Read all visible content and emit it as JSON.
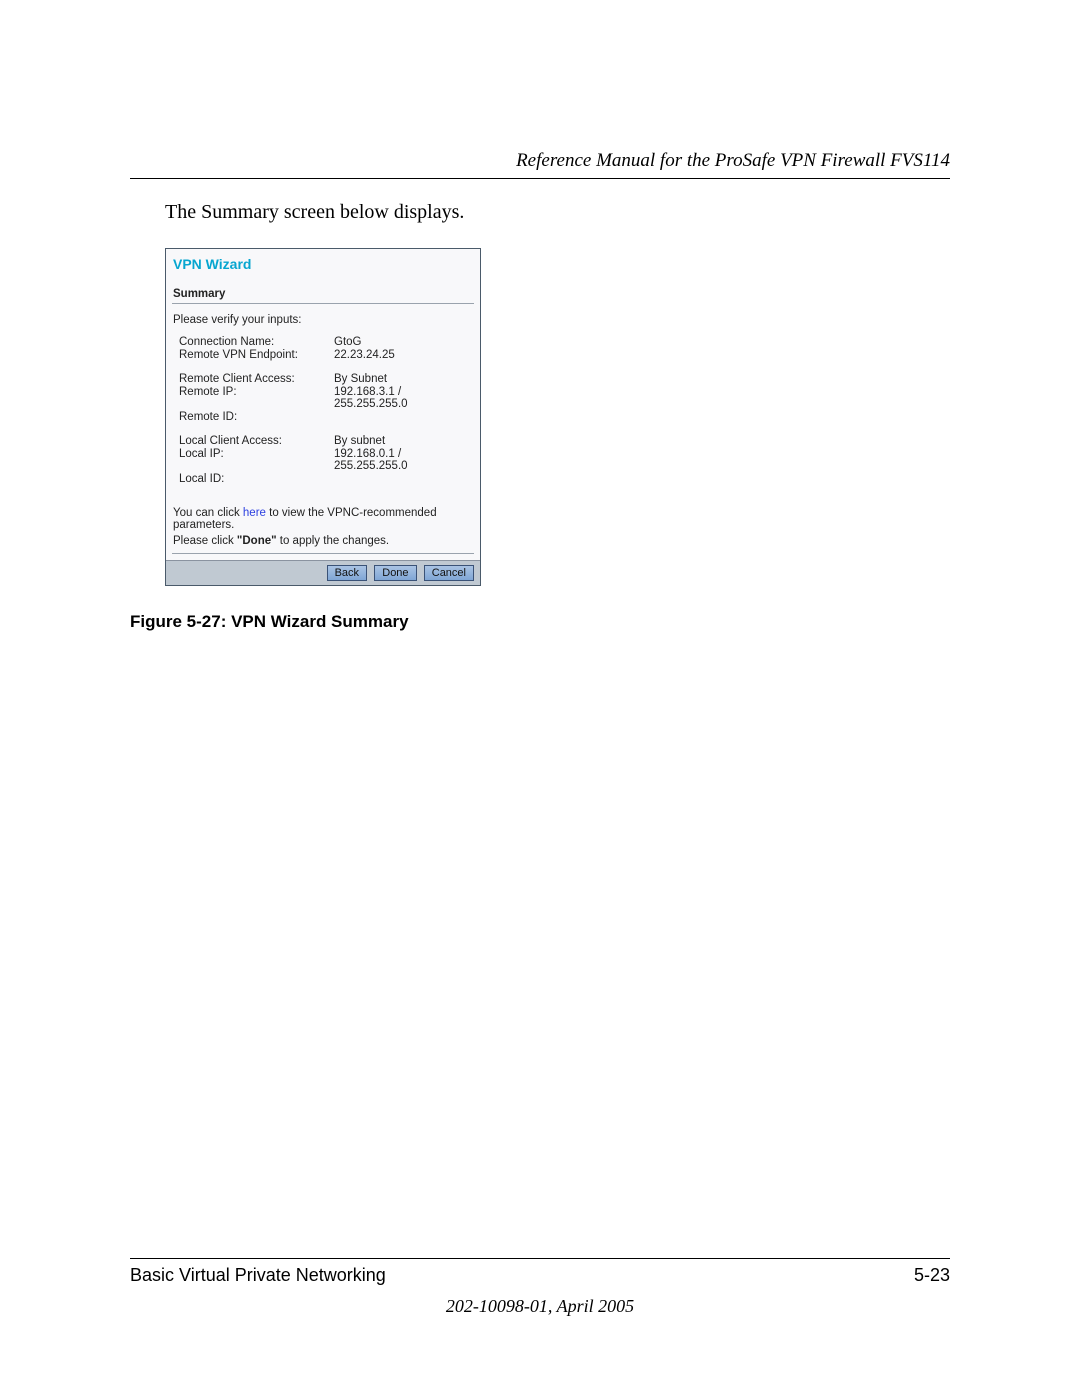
{
  "header": {
    "title": "Reference Manual for the ProSafe VPN Firewall FVS114"
  },
  "intro_text": "The Summary screen below displays.",
  "wizard": {
    "title": "VPN Wizard",
    "section": "Summary",
    "verify": "Please verify your inputs:",
    "fields": {
      "conn_label": "Connection Name:",
      "conn_val": "GtoG",
      "remote_ep_label": "Remote VPN Endpoint:",
      "remote_ep_val": "22.23.24.25",
      "rca_label": "Remote Client Access:",
      "rca_val": "By Subnet",
      "remote_ip_label": "Remote IP:",
      "remote_ip_val": "192.168.3.1 / 255.255.255.0",
      "remote_id_label": "Remote ID:",
      "remote_id_val": "",
      "lca_label": "Local Client Access:",
      "lca_val": "By subnet",
      "local_ip_label": "Local IP:",
      "local_ip_val": "192.168.0.1 / 255.255.255.0",
      "local_id_label": "Local ID:",
      "local_id_val": ""
    },
    "note_pre": "You can click ",
    "note_link": "here",
    "note_post": " to view the VPNC-recommended parameters.",
    "apply_pre": "Please click ",
    "apply_bold": "\"Done\"",
    "apply_post": " to apply the changes.",
    "buttons": {
      "back": "Back",
      "done": "Done",
      "cancel": "Cancel"
    }
  },
  "figure_caption": "Figure 5-27:  VPN Wizard Summary",
  "footer": {
    "left": "Basic Virtual Private Networking",
    "right": "5-23",
    "docnum": "202-10098-01, April 2005"
  }
}
